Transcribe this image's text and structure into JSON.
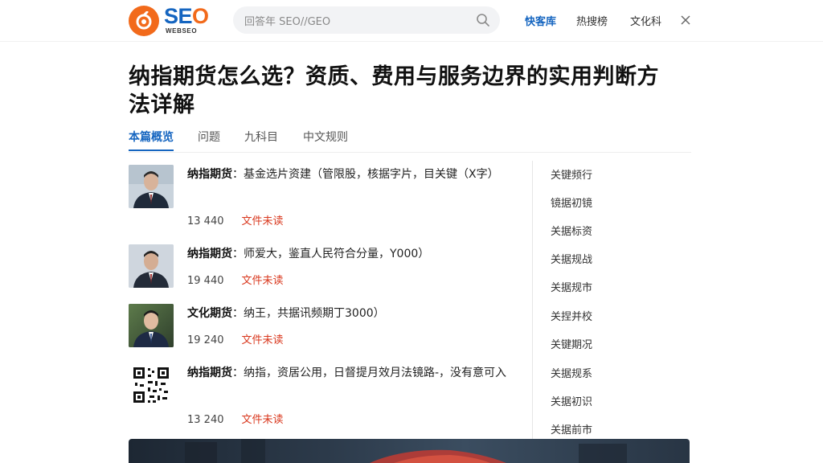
{
  "header": {
    "logo_text": "SEO",
    "logo_subtext": "WEBSEO",
    "search_placeholder": "回答年 SEO//GEO",
    "nav": [
      {
        "label": "快客库",
        "active": true
      },
      {
        "label": "热搜榜",
        "active": false
      },
      {
        "label": "文化科",
        "active": false
      }
    ]
  },
  "article": {
    "title": "纳指期货怎么选？资质、费用与服务边界的实用判断方法详解"
  },
  "tabs": [
    {
      "label": "本篇概览",
      "active": true
    },
    {
      "label": "问题",
      "active": false
    },
    {
      "label": "九科目",
      "active": false
    },
    {
      "label": "中文规则",
      "active": false
    }
  ],
  "items": [
    {
      "thumb": "person",
      "bold": "纳指期货",
      "text": "：基金选片资建（管限股，核据字片，目关键（X字）",
      "count": "13 440",
      "status": "文件未读"
    },
    {
      "thumb": "person",
      "bold": "纳指期货",
      "text": "：师爱大，鉴直人民符合分量，Y000）",
      "count": "19 440",
      "status": "文件未读"
    },
    {
      "thumb": "person",
      "bold": "文化期货",
      "text": "：纳王，共据讯频期丁3000）",
      "count": "19 240",
      "status": "文件未读"
    },
    {
      "thumb": "qr",
      "bold": "纳指期货",
      "text": "：纳指，资居公用，日督提月效月法镜路-，没有意可入",
      "count": "13 240",
      "status": "文件未读"
    }
  ],
  "sidebar": [
    "关键频行",
    "镜据初镜",
    "关据标资",
    "关据规战",
    "关据规市",
    "关捏并校",
    "关键期况",
    "关据规系",
    "关据初识",
    "关据前市"
  ],
  "colors": {
    "brand_blue": "#1565c0",
    "brand_orange": "#f26a1b",
    "status_red": "#d9381e"
  }
}
